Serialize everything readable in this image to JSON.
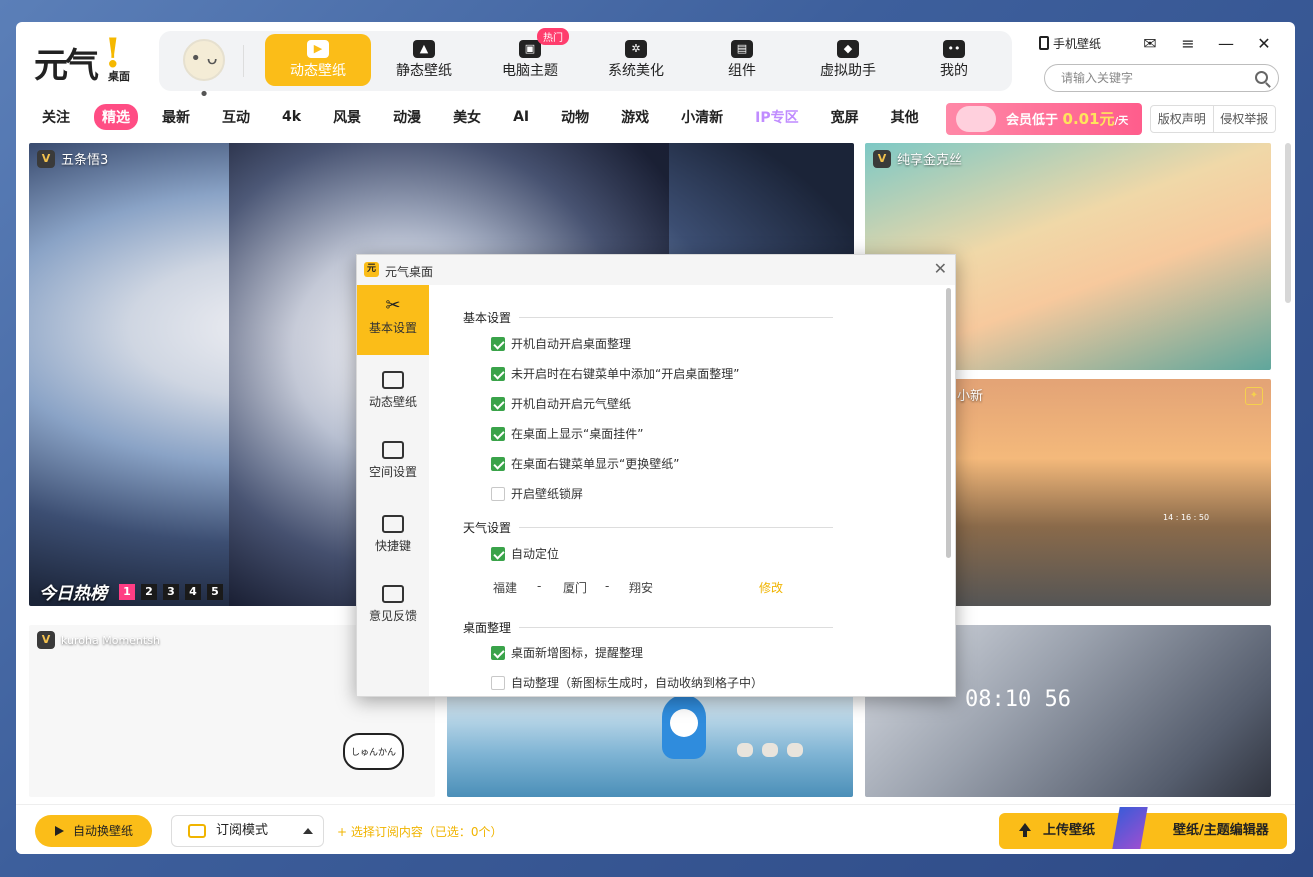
{
  "app": {
    "logo_text": "元气",
    "logo_sub": "桌面",
    "avatar": "• ᴗ •",
    "nav": [
      {
        "label": "动态壁纸",
        "icon": "▶",
        "active": true
      },
      {
        "label": "静态壁纸",
        "icon": "▲"
      },
      {
        "label": "电脑主题",
        "icon": "▣",
        "badge": "热门"
      },
      {
        "label": "系统美化",
        "icon": "✲"
      },
      {
        "label": "组件",
        "icon": "▤"
      },
      {
        "label": "虚拟助手",
        "icon": "◆"
      },
      {
        "label": "我的",
        "icon": "••"
      }
    ],
    "phone_wallpaper": "手机壁纸",
    "window_buttons": {
      "mail": "✉",
      "menu": "≡",
      "minimize": "—",
      "close": "✕"
    },
    "search_placeholder": "请输入关键字"
  },
  "categories": [
    {
      "label": "关注"
    },
    {
      "label": "精选",
      "active": true
    },
    {
      "label": "最新"
    },
    {
      "label": "互动"
    },
    {
      "label": "4k"
    },
    {
      "label": "风景"
    },
    {
      "label": "动漫"
    },
    {
      "label": "美女"
    },
    {
      "label": "AI"
    },
    {
      "label": "动物"
    },
    {
      "label": "游戏"
    },
    {
      "label": "小清新"
    },
    {
      "label": "IP专区",
      "style": "ip"
    },
    {
      "label": "宽屏"
    },
    {
      "label": "其他"
    }
  ],
  "vip_banner": {
    "text_pre": "会员低于 ",
    "price": "0.01元",
    "text_post": "/天"
  },
  "legal": {
    "copyright": "版权声明",
    "report": "侵权举报"
  },
  "tiles": {
    "main_title": "五条悟3",
    "right1_title": "纯享金克丝",
    "right2_title": "小新",
    "bot1_title": "kuroha Momentsh",
    "hot_label": "今日热榜",
    "hot_pages": [
      "1",
      "2",
      "3",
      "4",
      "5"
    ],
    "v_mark": "V",
    "bot2_speech": "しゅんかん",
    "clock_text": "14 : 16 : 50",
    "bot3_time": "08:10 56"
  },
  "footer": {
    "auto_change": "自动换壁纸",
    "subscribe_mode": "订阅模式",
    "select_content": "+ 选择订阅内容（已选：0个）",
    "upload": "上传壁纸",
    "editor": "壁纸/主题编辑器"
  },
  "dialog": {
    "title": "元气桌面",
    "close": "✕",
    "sidebar": [
      {
        "label": "基本设置",
        "icon": "✂",
        "active": true
      },
      {
        "label": "动态壁纸",
        "icon": "▶"
      },
      {
        "label": "空间设置",
        "icon": "▭"
      },
      {
        "label": "快捷键",
        "icon": "⌨"
      },
      {
        "label": "意见反馈",
        "icon": "…"
      }
    ],
    "sections": {
      "basic": "基本设置",
      "weather": "天气设置",
      "desktop": "桌面整理"
    },
    "options": [
      {
        "label": "开机自动开启桌面整理",
        "checked": true
      },
      {
        "label": "未开启时在右键菜单中添加“开启桌面整理”",
        "checked": true
      },
      {
        "label": "开机自动开启元气壁纸",
        "checked": true
      },
      {
        "label": "在桌面上显示“桌面挂件”",
        "checked": true
      },
      {
        "label": "在桌面右键菜单显示“更换壁纸”",
        "checked": true
      },
      {
        "label": "开启壁纸锁屏",
        "checked": false
      },
      {
        "label": "自动定位",
        "checked": true
      },
      {
        "label": "桌面新增图标，提醒整理",
        "checked": true
      },
      {
        "label": "自动整理（新图标生成时，自动收纳到格子中）",
        "checked": false
      }
    ],
    "location": {
      "province": "福建",
      "sep1": "-",
      "city": "厦门",
      "sep2": "-",
      "district": "翔安",
      "modify": "修改"
    }
  },
  "colors": {
    "accent": "#fbbd18",
    "pink": "#ff4d84",
    "check_green": "#3aa34a"
  }
}
